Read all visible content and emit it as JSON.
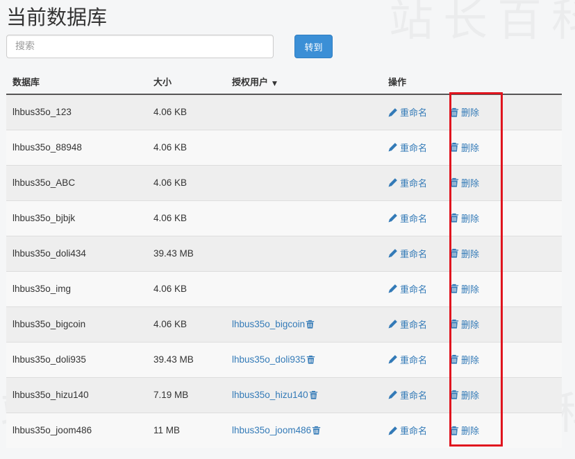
{
  "page_title": "当前数据库",
  "search": {
    "placeholder": "搜索"
  },
  "go_button_label": "转到",
  "table": {
    "headers": {
      "database": "数据库",
      "size": "大小",
      "users": "授权用户",
      "actions": "操作"
    },
    "rename_label": "重命名",
    "delete_label": "删除",
    "rows": [
      {
        "name": "lhbus35o_123",
        "size": "4.06 KB",
        "user": ""
      },
      {
        "name": "lhbus35o_88948",
        "size": "4.06 KB",
        "user": ""
      },
      {
        "name": "lhbus35o_ABC",
        "size": "4.06 KB",
        "user": ""
      },
      {
        "name": "lhbus35o_bjbjk",
        "size": "4.06 KB",
        "user": ""
      },
      {
        "name": "lhbus35o_doli434",
        "size": "39.43 MB",
        "user": ""
      },
      {
        "name": "lhbus35o_img",
        "size": "4.06 KB",
        "user": ""
      },
      {
        "name": "lhbus35o_bigcoin",
        "size": "4.06 KB",
        "user": "lhbus35o_bigcoin"
      },
      {
        "name": "lhbus35o_doli935",
        "size": "39.43 MB",
        "user": "lhbus35o_doli935"
      },
      {
        "name": "lhbus35o_hizu140",
        "size": "7.19 MB",
        "user": "lhbus35o_hizu140"
      },
      {
        "name": "lhbus35o_joom486",
        "size": "11 MB",
        "user": "lhbus35o_joom486"
      }
    ]
  },
  "icons": {
    "rename": "pencil-icon",
    "delete": "trash-icon",
    "sort": "caret-down-icon"
  },
  "colors": {
    "link": "#337ab7",
    "button": "#3b8fd6",
    "highlight": "#e0141e"
  }
}
